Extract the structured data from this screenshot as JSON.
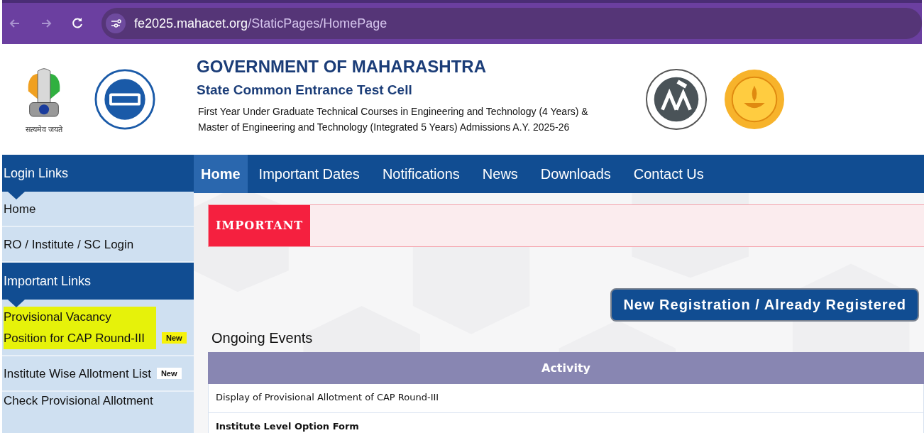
{
  "browser": {
    "url_host": "fe2025.mahacet.org",
    "url_path": "/StaticPages/HomePage"
  },
  "header": {
    "emblem_motto": "सत्यमेव जयते",
    "title": "GOVERNMENT OF MAHARASHTRA",
    "subtitle": "State Common Entrance Test Cell",
    "description_lines": [
      "First Year Under Graduate Technical Courses in Engineering and Technology (4 Years) &",
      "Master of Engineering and Technology (Integrated 5 Years) Admissions A.Y. 2025-26"
    ]
  },
  "nav": [
    {
      "label": "Home",
      "selected": true
    },
    {
      "label": "Important Dates",
      "selected": false
    },
    {
      "label": "Notifications",
      "selected": false
    },
    {
      "label": "News",
      "selected": false
    },
    {
      "label": "Downloads",
      "selected": false
    },
    {
      "label": "Contact Us",
      "selected": false
    }
  ],
  "sidebar": [
    {
      "kind": "heading",
      "label": "Login Links"
    },
    {
      "kind": "link",
      "label": "Home",
      "highlighted": false
    },
    {
      "kind": "link",
      "label": "RO / Institute / SC Login",
      "highlighted": false
    },
    {
      "kind": "heading",
      "label": "Important Links"
    },
    {
      "kind": "link",
      "label": "Provisional Vacancy Position for CAP Round-III",
      "badge": "New",
      "highlighted": true
    },
    {
      "kind": "link",
      "label": "Institute Wise Allotment List",
      "badge": "New",
      "highlighted": false
    },
    {
      "kind": "link",
      "label": "Check Provisional Allotment",
      "highlighted": false
    }
  ],
  "important_label": "IMPORTANT",
  "register_button": "New Registration / Already Registered",
  "ongoing": {
    "title": "Ongoing Events",
    "column": "Activity",
    "rows": [
      {
        "text": "Display of Provisional Allotment of CAP Round-III",
        "bold": false
      },
      {
        "text": "Institute Level Option Form",
        "bold": true
      }
    ]
  }
}
